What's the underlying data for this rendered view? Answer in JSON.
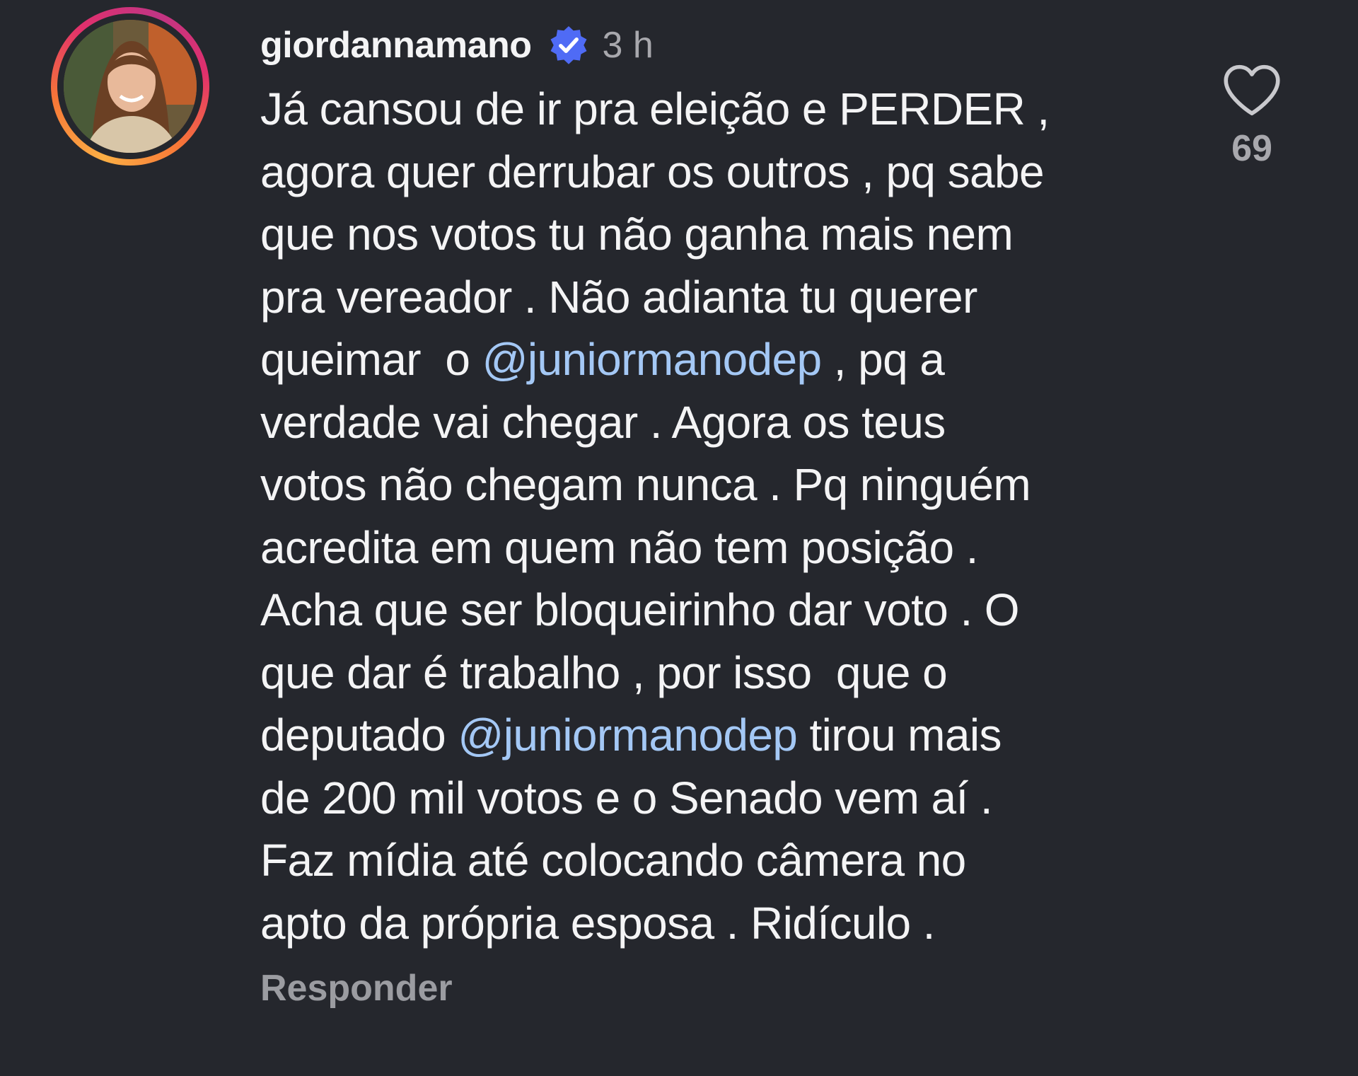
{
  "comment": {
    "username": "giordannamano",
    "verified": true,
    "time": "3 h",
    "lines": [
      [
        {
          "t": "Já cansou de ir pra eleição e PERDER ,"
        }
      ],
      [
        {
          "t": "agora quer derrubar os outros , pq sabe"
        }
      ],
      [
        {
          "t": "que nos votos tu não ganha mais nem"
        }
      ],
      [
        {
          "t": "pra vereador . Não adianta tu querer"
        }
      ],
      [
        {
          "t": "queimar  o "
        },
        {
          "t": "@juniormanodep",
          "m": true
        },
        {
          "t": " , pq a"
        }
      ],
      [
        {
          "t": "verdade vai chegar . Agora os teus"
        }
      ],
      [
        {
          "t": "votos não chegam nunca . Pq ninguém"
        }
      ],
      [
        {
          "t": "acredita em quem não tem posição ."
        }
      ],
      [
        {
          "t": "Acha que ser bloqueirinho dar voto . O"
        }
      ],
      [
        {
          "t": "que dar é trabalho , por isso  que o"
        }
      ],
      [
        {
          "t": "deputado "
        },
        {
          "t": "@juniormanodep",
          "m": true
        },
        {
          "t": " tirou mais"
        }
      ],
      [
        {
          "t": "de 200 mil votos e o Senado vem aí ."
        }
      ],
      [
        {
          "t": "Faz mídia até colocando câmera no"
        }
      ],
      [
        {
          "t": "apto da própria esposa . Ridículo ."
        }
      ]
    ],
    "reply_label": "Responder",
    "like_count": "69",
    "icons": {
      "verified": "verified-badge-icon",
      "like": "heart-icon"
    },
    "colors": {
      "background": "#25272d",
      "text": "#f4f4f5",
      "mention": "#a4c8f5",
      "muted": "#a8a8ad",
      "verified": "#4f6bf5"
    }
  }
}
